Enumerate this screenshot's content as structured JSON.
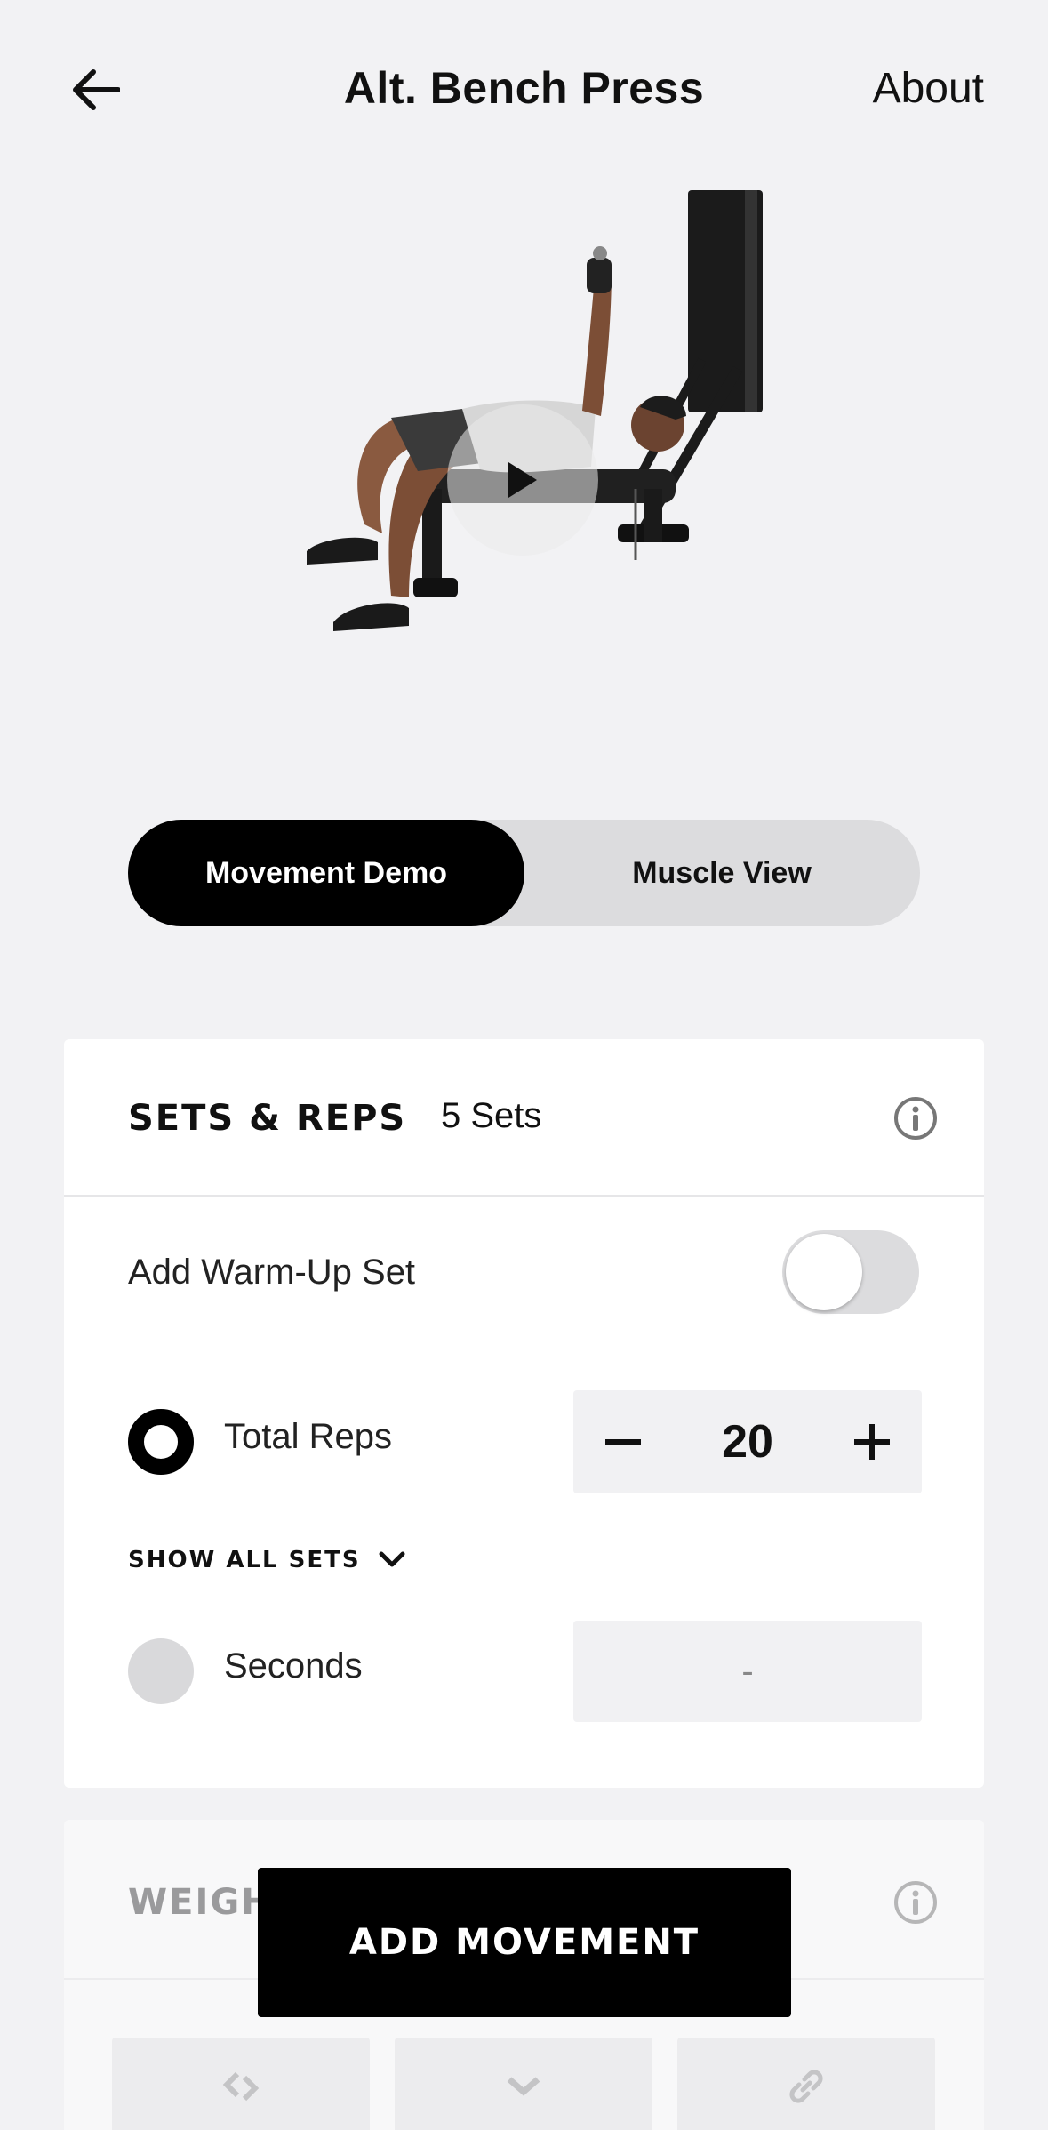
{
  "header": {
    "title": "Alt. Bench Press",
    "about_label": "About"
  },
  "hero": {
    "play_icon": "play-icon"
  },
  "segmented": {
    "options": [
      "Movement Demo",
      "Muscle View"
    ],
    "selected": "Movement Demo"
  },
  "sets_reps": {
    "title": "SETS & REPS",
    "sets_label": "5 Sets",
    "warmup_label": "Add Warm-Up Set",
    "warmup_enabled": false,
    "total_reps_label": "Total Reps",
    "total_reps_value": "20",
    "show_all_label": "SHOW ALL SETS",
    "seconds_label": "Seconds",
    "seconds_value": "-"
  },
  "weight": {
    "title": "WEIGHT"
  },
  "cta": {
    "label": "ADD MOVEMENT"
  },
  "colors": {
    "background": "#f2f2f4",
    "primary": "#000000",
    "card": "#ffffff",
    "muted": "#dcdcde"
  }
}
